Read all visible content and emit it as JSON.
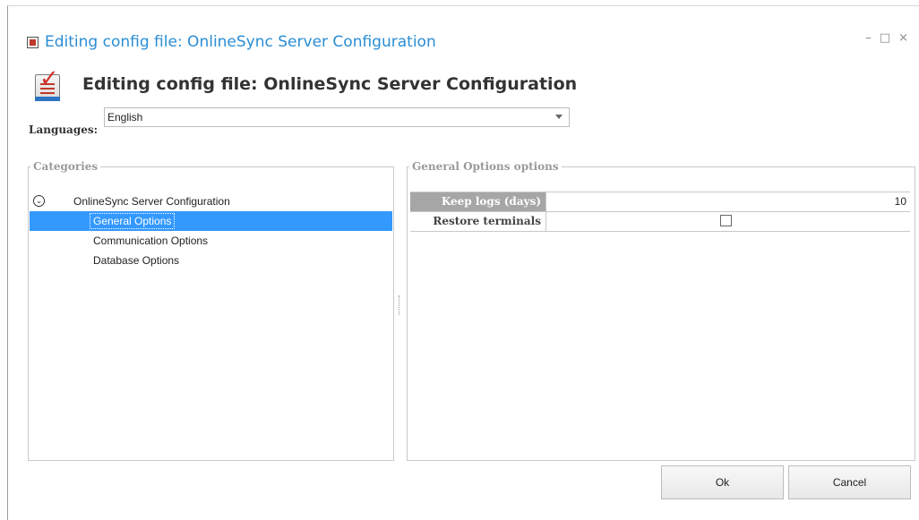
{
  "window": {
    "title": "Editing config file: OnlineSync Server Configuration",
    "controls": {
      "minimize": "–",
      "maximize": "□",
      "close": "×"
    }
  },
  "header": {
    "title": "Editing config file: OnlineSync Server Configuration",
    "icon": "checklist-icon"
  },
  "languages": {
    "label": "Languages:",
    "selected": "English"
  },
  "categories": {
    "legend": "Categories",
    "root": {
      "label": "OnlineSync Server Configuration",
      "expanded": true
    },
    "items": [
      {
        "label": "General Options",
        "selected": true
      },
      {
        "label": "Communication Options",
        "selected": false
      },
      {
        "label": "Database Options",
        "selected": false
      }
    ]
  },
  "options": {
    "legend": "General Options options",
    "rows": [
      {
        "key": "Keep logs (days)",
        "value": "10"
      },
      {
        "key": "Restore terminals",
        "checked": false
      }
    ]
  },
  "buttons": {
    "ok": "Ok",
    "cancel": "Cancel"
  },
  "colors": {
    "title": "#2a8dd4",
    "selection": "#3399ff",
    "active_key": "#a6a6a6"
  }
}
